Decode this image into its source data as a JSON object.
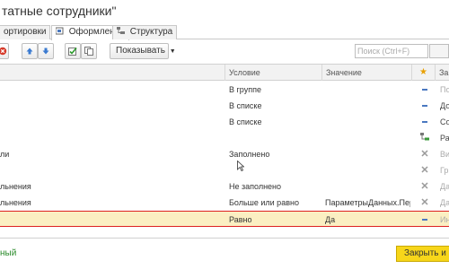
{
  "window": {
    "title": "татные сотрудники\""
  },
  "tabs": [
    {
      "label": "ортировки"
    },
    {
      "label": "Оформление"
    },
    {
      "label": "Структура"
    }
  ],
  "toolbar": {
    "show_label": "Показывать",
    "search_placeholder": "Поиск (Ctrl+F)"
  },
  "grid": {
    "headers": {
      "condition": "Условие",
      "value": "Значение",
      "star": "★",
      "tail": "За"
    },
    "rows": [
      {
        "name": "",
        "condition": "В группе",
        "value": "",
        "icon": "dash",
        "tail": "По"
      },
      {
        "name": "",
        "condition": "В списке",
        "value": "",
        "icon": "dash",
        "tail": "До"
      },
      {
        "name": "",
        "condition": "В списке",
        "value": "",
        "icon": "dash",
        "tail": "Со"
      },
      {
        "name": "",
        "condition": "",
        "value": "",
        "icon": "tree",
        "tail": "Ра"
      },
      {
        "name": "ли",
        "condition": "Заполнено",
        "value": "",
        "icon": "x",
        "tail": "Ви"
      },
      {
        "name": "",
        "condition": "",
        "value": "",
        "icon": "x",
        "tail": "Гр"
      },
      {
        "name": "льнения",
        "condition": "Не заполнено",
        "value": "",
        "icon": "x",
        "tail": "Да"
      },
      {
        "name": "льнения",
        "condition": "Больше или равно",
        "value": "ПараметрыДанных.Пер…",
        "icon": "x",
        "tail": "Да"
      },
      {
        "name": "",
        "condition": "Равно",
        "value": "Да",
        "icon": "dash",
        "tail": "Ин"
      }
    ]
  },
  "footer": {
    "left_label": "ный",
    "close_label": "Закрыть и с"
  },
  "colors": {
    "selection": "#fbefc2",
    "selection_border": "#dd2222",
    "accent_yellow": "#f7d61a",
    "icon_blue": "#4a78c0"
  }
}
